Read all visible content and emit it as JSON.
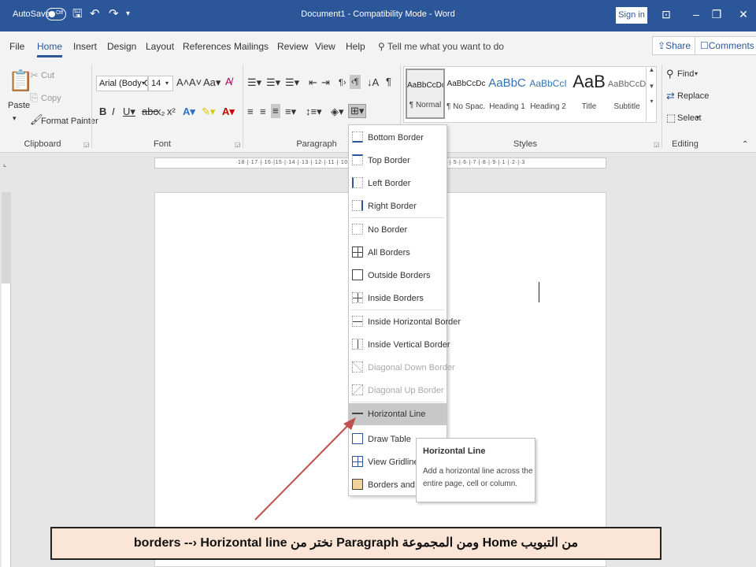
{
  "titlebar": {
    "autosave_label": "AutoSave",
    "autosave_state": "Off",
    "document_title": "Document1 - Compatibility Mode - Word",
    "sign_in": "Sign in"
  },
  "tabs": {
    "items": [
      "File",
      "Home",
      "Insert",
      "Design",
      "Layout",
      "References",
      "Mailings",
      "Review",
      "View",
      "Help"
    ],
    "active": "Home",
    "tell_me": "Tell me what you want to do",
    "share": "Share",
    "comments": "Comments"
  },
  "ribbon": {
    "clipboard": {
      "label": "Clipboard",
      "paste": "Paste",
      "cut": "Cut",
      "copy": "Copy",
      "format_painter": "Format Painter"
    },
    "font": {
      "label": "Font",
      "font_name": "Arial (Body CS)",
      "font_size": "14"
    },
    "paragraph": {
      "label": "Paragraph"
    },
    "styles": {
      "label": "Styles",
      "items": [
        {
          "sample": "AaBbCcDc",
          "name": "¶ Normal"
        },
        {
          "sample": "AaBbCcDc",
          "name": "¶ No Spac..."
        },
        {
          "sample": "AaBbC",
          "name": "Heading 1"
        },
        {
          "sample": "AaBbCcI",
          "name": "Heading 2"
        },
        {
          "sample": "AaB",
          "name": "Title"
        },
        {
          "sample": "AaBbCcD",
          "name": "Subtitle"
        }
      ]
    },
    "editing": {
      "label": "Editing",
      "find": "Find",
      "replace": "Replace",
      "select": "Select"
    }
  },
  "ruler": {
    "ticks": "·18·|·17·|·16·|15·|·14·|·13·|·12·|·11·|·10·|·9·|·8·|·7·|·6·|·5·|·4·|·3·|·2·|·1·|    ·4·|·5·|·6·|·7·|·8·|·9·|·1·|·2·|·3"
  },
  "borders_menu": {
    "items": [
      {
        "label": "Bottom Border",
        "enabled": true
      },
      {
        "label": "Top Border",
        "enabled": true
      },
      {
        "label": "Left Border",
        "enabled": true
      },
      {
        "label": "Right Border",
        "enabled": true
      },
      {
        "label": "No Border",
        "enabled": true
      },
      {
        "label": "All Borders",
        "enabled": true
      },
      {
        "label": "Outside Borders",
        "enabled": true
      },
      {
        "label": "Inside Borders",
        "enabled": true
      },
      {
        "label": "Inside Horizontal Border",
        "enabled": true
      },
      {
        "label": "Inside Vertical Border",
        "enabled": true
      },
      {
        "label": "Diagonal Down Border",
        "enabled": false
      },
      {
        "label": "Diagonal Up Border",
        "enabled": false
      },
      {
        "label": "Horizontal Line",
        "enabled": true
      },
      {
        "label": "Draw Table",
        "enabled": true
      },
      {
        "label": "View Gridlines",
        "enabled": true
      },
      {
        "label": "Borders and Shading...",
        "enabled": true
      }
    ],
    "highlighted": "Horizontal Line"
  },
  "tooltip": {
    "title": "Horizontal Line",
    "body": "Add a horizontal line across the entire page, cell or column."
  },
  "caption": {
    "text": "من التبويب Home ومن المجموعة Paragraph نختر من  borders --› Horizontal line"
  },
  "colors": {
    "title_bar": "#2b579a",
    "ribbon_bg": "#f3f3f3",
    "caption_bg": "#fbe5d6",
    "arrow": "#c0504d"
  }
}
